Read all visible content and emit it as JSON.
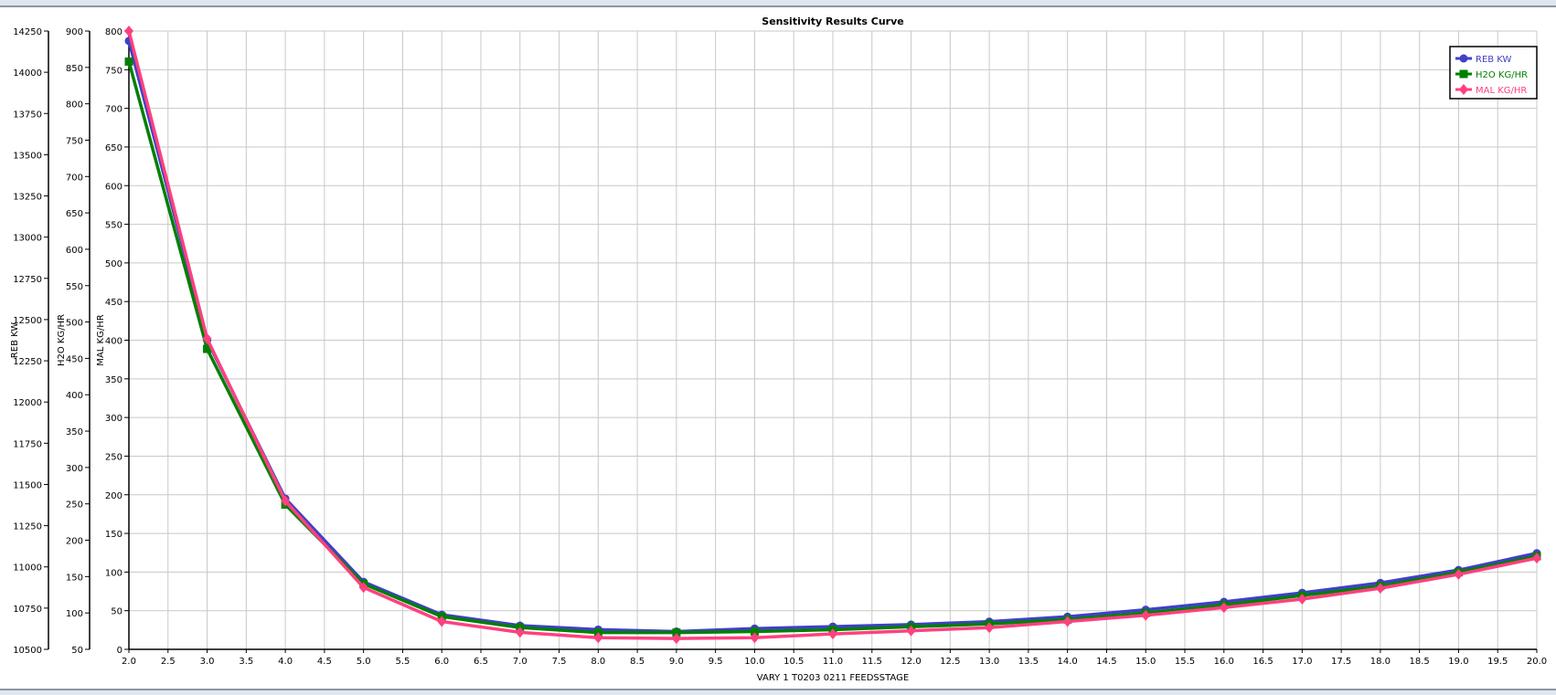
{
  "chart_data": {
    "type": "line",
    "title": "Sensitivity Results Curve",
    "xlabel": "VARY  1 T0203 0211 FEEDSSTAGE",
    "xlim": [
      2.0,
      20.0
    ],
    "xticks": [
      "2.0",
      "2.5",
      "3.0",
      "3.5",
      "4.0",
      "4.5",
      "5.0",
      "5.5",
      "6.0",
      "6.5",
      "7.0",
      "7.5",
      "8.0",
      "8.5",
      "9.0",
      "9.5",
      "10.0",
      "10.5",
      "11.0",
      "11.5",
      "12.0",
      "12.5",
      "13.0",
      "13.5",
      "14.0",
      "14.5",
      "15.0",
      "15.5",
      "16.0",
      "16.5",
      "17.0",
      "17.5",
      "18.0",
      "18.5",
      "19.0",
      "19.5",
      "20.0"
    ],
    "grid": true,
    "legend_position": "top-right",
    "x": [
      2,
      3,
      4,
      5,
      6,
      7,
      8,
      9,
      10,
      11,
      12,
      13,
      14,
      15,
      16,
      17,
      18,
      19,
      20
    ],
    "axes": [
      {
        "label": "REB KW",
        "ylim": [
          10500,
          14250
        ],
        "step": 250
      },
      {
        "label": "H2O KG/HR",
        "ylim": [
          50,
          900
        ],
        "step": 50
      },
      {
        "label": "MAL KG/HR",
        "ylim": [
          0,
          800
        ],
        "step": 50
      }
    ],
    "series": [
      {
        "name": "REB KW",
        "axis": 0,
        "color": "#4040c8",
        "marker": "circle",
        "values": [
          14190,
          12375,
          11414,
          10909,
          10710,
          10644,
          10620,
          10608,
          10626,
          10638,
          10650,
          10668,
          10698,
          10740,
          10788,
          10843,
          10903,
          10981,
          11083
        ]
      },
      {
        "name": "H2O KG/HR",
        "axis": 1,
        "color": "#008000",
        "marker": "square",
        "values": [
          858,
          463,
          249,
          140,
          95,
          80,
          73,
          73,
          74.5,
          77,
          81,
          85,
          91,
          100,
          111,
          124,
          137,
          156,
          178
        ]
      },
      {
        "name": "MAL KG/HR",
        "axis": 2,
        "color": "#ff4080",
        "marker": "diamond",
        "values": [
          800,
          402,
          192,
          80,
          36,
          22,
          15,
          14,
          15,
          20,
          24,
          28,
          36,
          44,
          54,
          65,
          79,
          97,
          118
        ]
      }
    ]
  }
}
